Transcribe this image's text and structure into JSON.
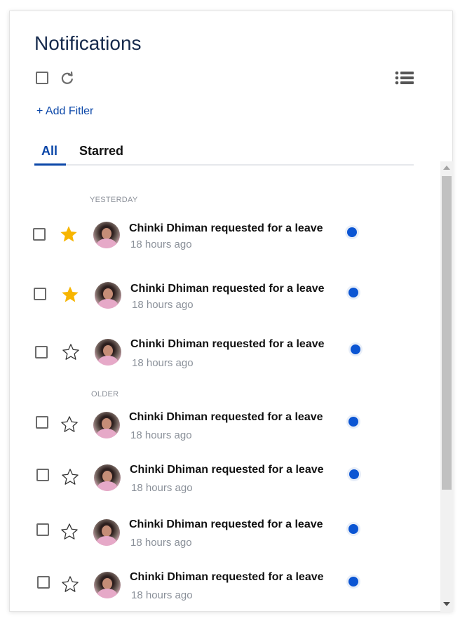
{
  "panel": {
    "title": "Notifications",
    "add_filter_label": "+ Add Fitler",
    "tabs": [
      {
        "label": "All",
        "active": true
      },
      {
        "label": "Starred",
        "active": false
      }
    ]
  },
  "icons": {
    "select_all": "checkbox-icon",
    "refresh": "refresh-icon",
    "view_options": "list-icon",
    "unread": "unread-dot-icon"
  },
  "colors": {
    "title": "#172b4d",
    "accent": "#0b47a8",
    "star_filled": "#f7b500",
    "unread_dot": "#0b55d3"
  },
  "sections": [
    {
      "label": "YESTERDAY",
      "items": [
        {
          "text": "Chinki Dhiman requested for a leave",
          "time": "18 hours ago",
          "starred": true,
          "unread": true
        },
        {
          "text": "Chinki Dhiman requested for a leave",
          "time": "18 hours ago",
          "starred": true,
          "unread": true
        },
        {
          "text": "Chinki Dhiman requested for a leave",
          "time": "18 hours ago",
          "starred": false,
          "unread": true
        }
      ]
    },
    {
      "label": "OLDER",
      "items": [
        {
          "text": "Chinki Dhiman requested for a leave",
          "time": "18 hours ago",
          "starred": false,
          "unread": true
        },
        {
          "text": "Chinki Dhiman requested for a leave",
          "time": "18 hours ago",
          "starred": false,
          "unread": true
        },
        {
          "text": "Chinki Dhiman requested for a leave",
          "time": "18 hours ago",
          "starred": false,
          "unread": true
        },
        {
          "text": "Chinki Dhiman requested for a leave",
          "time": "18 hours ago",
          "starred": false,
          "unread": true
        }
      ]
    }
  ]
}
